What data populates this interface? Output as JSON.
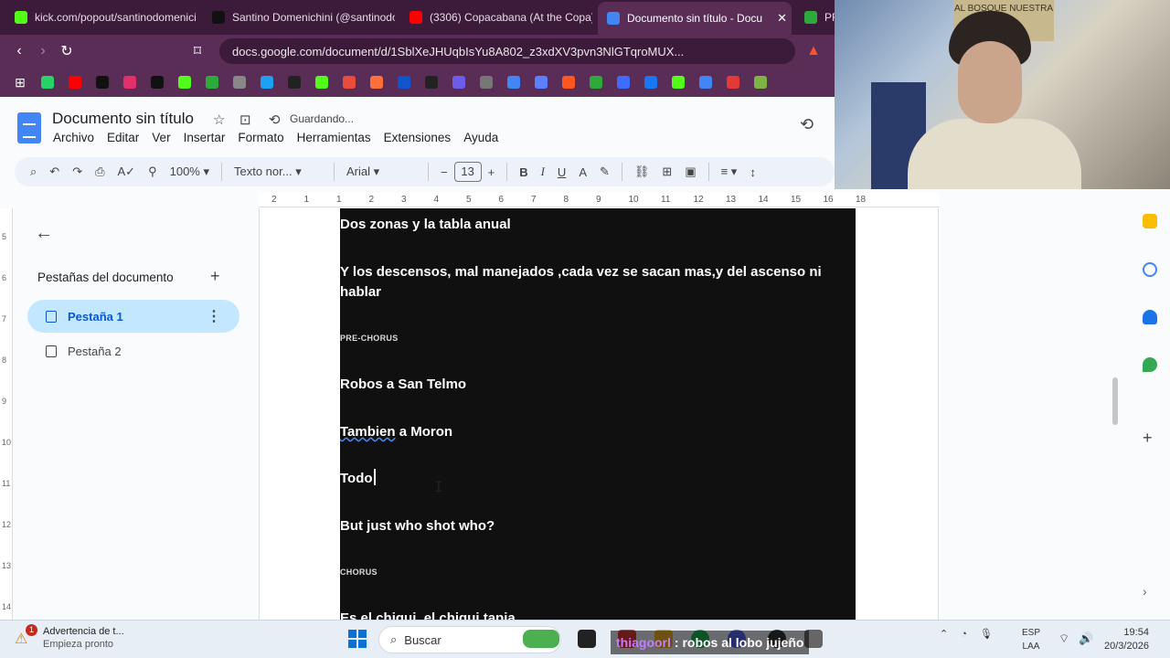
{
  "browser": {
    "tabs": [
      {
        "title": "kick.com/popout/santinodomenici",
        "color": "#53fc18"
      },
      {
        "title": "Santino Domenichini (@santinodo",
        "color": "#111111"
      },
      {
        "title": "(3306) Copacabana (At the Copa)",
        "color": "#ff0000"
      },
      {
        "title": "Documento sin título - Docu",
        "color": "#4285f4"
      },
      {
        "title": "PR",
        "color": "#2eaa3c"
      }
    ],
    "url": "docs.google.com/document/d/1SblXeJHUqbIsYu8A802_z3xdXV3pvn3NlGTqroMUX...",
    "bookmark_colors": [
      "#25d366",
      "#ff0000",
      "#111111",
      "#e1306c",
      "#111111",
      "#53fc18",
      "#2eaa3c",
      "#888888",
      "#1da1f2",
      "#222222",
      "#53fc18",
      "#ea4c3c",
      "#ff6f3c",
      "#1155cc",
      "#222222",
      "#6c5ce7",
      "#777777",
      "#4285f4",
      "#5b7fff",
      "#ff5722",
      "#2eaa3c",
      "#3d6cff",
      "#1877f2",
      "#53fc18",
      "#4285f4",
      "#e53935",
      "#7cb342"
    ]
  },
  "webcam": {
    "poster_text": "AL BOSQUE NUESTRA"
  },
  "docs": {
    "title": "Documento sin título",
    "status": "Guardando...",
    "menu": [
      "Archivo",
      "Editar",
      "Ver",
      "Insertar",
      "Formato",
      "Herramientas",
      "Extensiones",
      "Ayuda"
    ],
    "toolbar": {
      "zoom": "100%",
      "style": "Texto nor...",
      "font": "Arial",
      "font_size": "13"
    },
    "ruler_labels": [
      "2",
      "1",
      "1",
      "2",
      "3",
      "4",
      "5",
      "6",
      "7",
      "8",
      "9",
      "10",
      "11",
      "12",
      "13",
      "14",
      "15",
      "16",
      "18"
    ],
    "vruler_labels": [
      "5",
      "6",
      "7",
      "8",
      "9",
      "10",
      "11",
      "12",
      "13",
      "14"
    ],
    "sidepanel": {
      "title": "Pestañas del documento",
      "tabs": [
        "Pestaña 1",
        "Pestaña 2"
      ]
    },
    "content": [
      {
        "text": "Dos zonas y la tabla anual",
        "kind": "line"
      },
      {
        "text": "Y los descensos, mal manejados ,cada vez se sacan mas,y del ascenso ni",
        "kind": "line"
      },
      {
        "text": "hablar",
        "kind": "line"
      },
      {
        "text": "PRE-CHORUS",
        "kind": "small"
      },
      {
        "text": "Robos a San Telmo",
        "kind": "line"
      },
      {
        "text": "Tambien",
        "kind": "misspelled"
      },
      {
        "text": " a Moron",
        "kind": "line"
      },
      {
        "text": "Todo",
        "kind": "line"
      },
      {
        "text": "But just who shot who?",
        "kind": "line"
      },
      {
        "text": "CHORUS",
        "kind": "small"
      },
      {
        "text": "Es el chiqui, el chiqui tapia",
        "kind": "line"
      }
    ]
  },
  "taskbar": {
    "notification_title": "Advertencia de t...",
    "notification_sub": "Empieza pronto",
    "notification_badge": "1",
    "search_placeholder": "Buscar",
    "lang_top": "ESP",
    "lang_bottom": "LAA",
    "time": "19:54",
    "date": "20/3/2026"
  },
  "chat": {
    "user": "thiagoorl",
    "message": ": robos al lobo jujeño"
  }
}
